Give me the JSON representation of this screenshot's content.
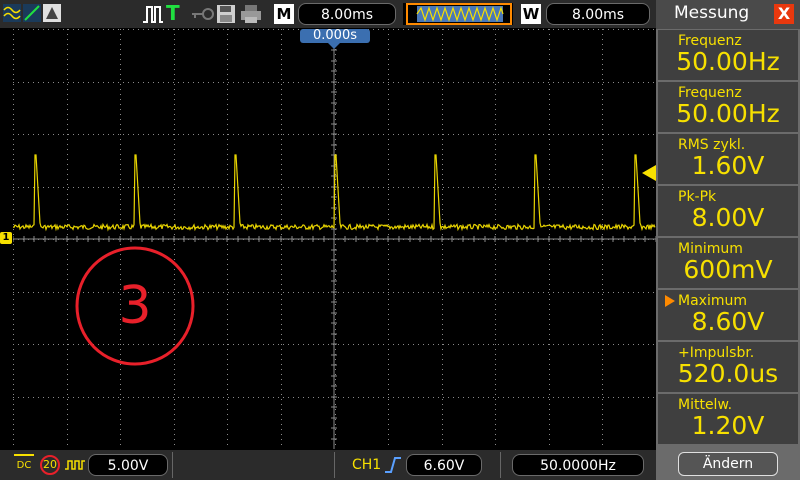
{
  "toolbar": {
    "m_label": "M",
    "timebase": "8.00ms",
    "w_label": "W",
    "window_timebase": "8.00ms",
    "trigger_label": "T",
    "icons": [
      "waveform-yellow-icon",
      "line-green-icon",
      "measure-icon",
      "pulse-trigger-icon",
      "key-icon",
      "floppy-icon",
      "printer-icon",
      "wave-preview-icon"
    ]
  },
  "screen": {
    "trigger_time": "0.000s",
    "overlay_number": "3",
    "channel_marker": "1",
    "colors": {
      "trace": "#e8d400",
      "grid": "#8a8a8a",
      "circle": "#e8202a"
    }
  },
  "bottom": {
    "coupling": "DC",
    "bw_limit": "20",
    "ch1_scale": "5.00V",
    "trig_channel": "CH1",
    "trig_level": "6.60V",
    "trig_freq": "50.0000Hz"
  },
  "sidebar": {
    "title": "Messung",
    "close": "X",
    "measurements": [
      {
        "label": "Frequenz",
        "value": "50.00Hz"
      },
      {
        "label": "Frequenz",
        "value": "50.00Hz"
      },
      {
        "label": "RMS  zykl.",
        "value": "1.60V"
      },
      {
        "label": "Pk-Pk",
        "value": "8.00V"
      },
      {
        "label": "Minimum",
        "value": "600mV"
      },
      {
        "label": "Maximum",
        "value": "8.60V"
      },
      {
        "label": "+Impulsbr.",
        "value": "520.0us"
      },
      {
        "label": "Mittelw.",
        "value": "1.20V"
      }
    ],
    "change_button": "Ändern"
  }
}
